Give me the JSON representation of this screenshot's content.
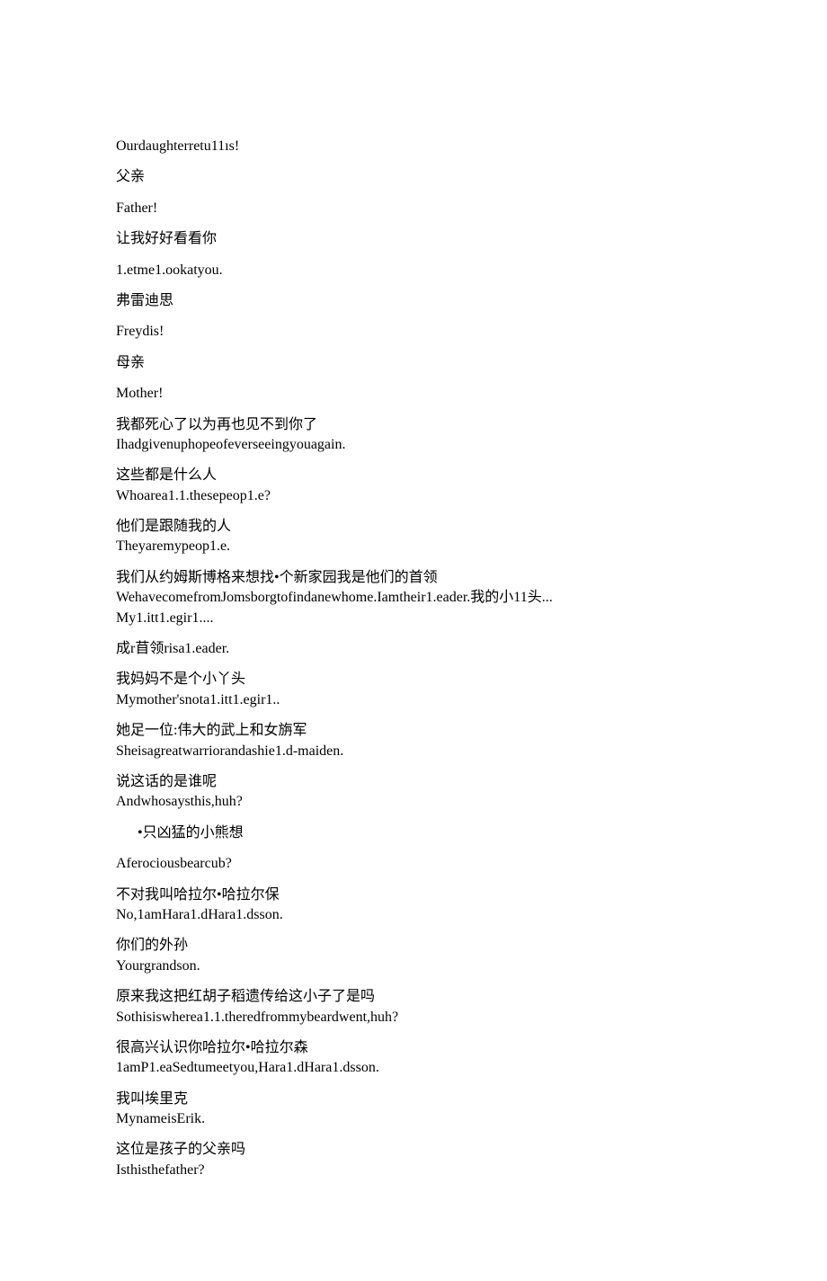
{
  "blocks": [
    {
      "lines": [
        "Ourdaughterretu11ıs!"
      ]
    },
    {
      "lines": [
        "父亲"
      ]
    },
    {
      "lines": [
        "Father!"
      ]
    },
    {
      "lines": [
        "让我好好看看你"
      ]
    },
    {
      "lines": [
        "1.etme1.ookatyou."
      ]
    },
    {
      "lines": [
        "弗雷迪思"
      ]
    },
    {
      "lines": [
        "Freydis!"
      ]
    },
    {
      "lines": [
        "母亲"
      ]
    },
    {
      "lines": [
        "Mother!"
      ]
    },
    {
      "lines": [
        "我都死心了以为再也见不到你了",
        "Ihadgivenuphopeofeverseeingyouagain."
      ]
    },
    {
      "lines": [
        "这些都是什么人",
        "Whoarea1.1.thesepeop1.e?"
      ]
    },
    {
      "lines": [
        "他们是跟随我的人",
        "Theyaremypeop1.e."
      ]
    },
    {
      "lines": [
        "我们从约姆斯博格来想找•个新家园我是他们的首领",
        "WehavecomefromJomsborgtofindanewhome.Iamtheir1.eader.我的小11头...",
        "My1.itt1.egir1...."
      ]
    },
    {
      "lines": [
        "成r苜领risa1.eader."
      ]
    },
    {
      "lines": [
        "我妈妈不是个小丫头",
        "Mymother'snota1.itt1.egir1.."
      ]
    },
    {
      "lines": [
        "她足一位:伟大的武上和女旃军",
        "Sheisagreatwarriorandashie1.d-maiden."
      ]
    },
    {
      "lines": [
        "说这话的是谁呢",
        "Andwhosaysthis,huh?"
      ]
    },
    {
      "lines": [
        "•只凶猛的小熊想"
      ],
      "indent": true
    },
    {
      "lines": [
        "Aferociousbearcub?"
      ]
    },
    {
      "lines": [
        "不对我叫哈拉尔•哈拉尔保",
        "No,1amHara1.dHara1.dsson."
      ]
    },
    {
      "lines": [
        "你们的外孙",
        "Yourgrandson."
      ]
    },
    {
      "lines": [
        "原来我这把红胡子稻遗传给这小子了是吗",
        "Sothisiswherea1.1.theredfrommybeardwent,huh?"
      ]
    },
    {
      "lines": [
        "很高兴认识你哈拉尔•哈拉尔森",
        "1amP1.eaSedtumeetyou,Hara1.dHara1.dsson."
      ]
    },
    {
      "lines": [
        "我叫埃里克",
        "MynameisErik."
      ]
    },
    {
      "lines": [
        "这位是孩子的父亲吗",
        "Isthisthefather?"
      ]
    }
  ]
}
